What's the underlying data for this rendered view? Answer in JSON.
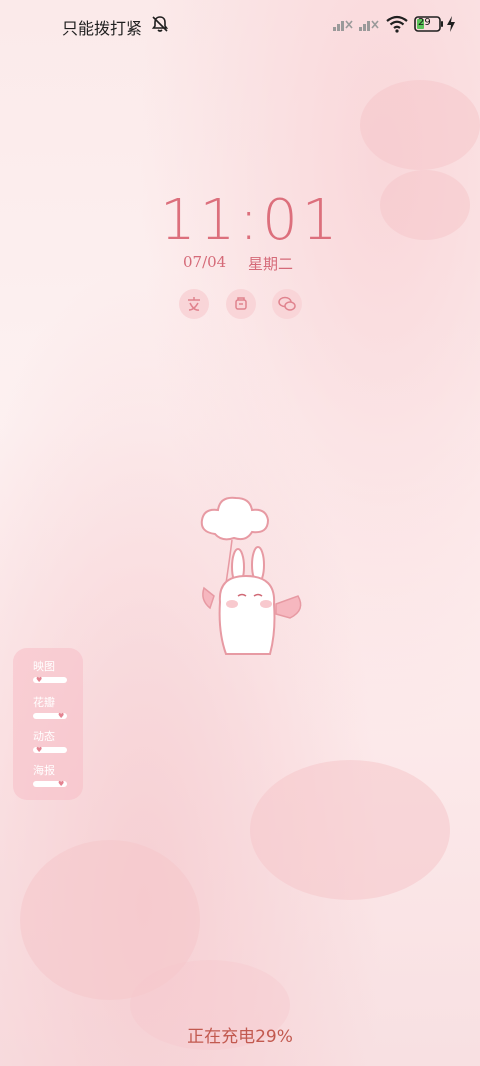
{
  "status_bar": {
    "mode_text": "只能拨打紧",
    "icons": [
      "bell-off-icon",
      "signal-icon",
      "signal-icon",
      "wifi-icon",
      "battery-icon",
      "charging-bolt-icon"
    ],
    "battery_level": "29"
  },
  "lockscreen": {
    "time": "11:01",
    "date": "07/04",
    "weekday": "星期二",
    "shortcuts": [
      "text-icon",
      "cup-icon",
      "chat-icon"
    ]
  },
  "widget": {
    "items": [
      {
        "label": "映图"
      },
      {
        "label": "花瓣"
      },
      {
        "label": "动态"
      },
      {
        "label": "海报"
      }
    ]
  },
  "footer": {
    "charging_text": "正在充电29%"
  },
  "colors": {
    "accent": "#dc6f7c",
    "charging_text": "#c2594f",
    "background": "#fbeaea"
  }
}
